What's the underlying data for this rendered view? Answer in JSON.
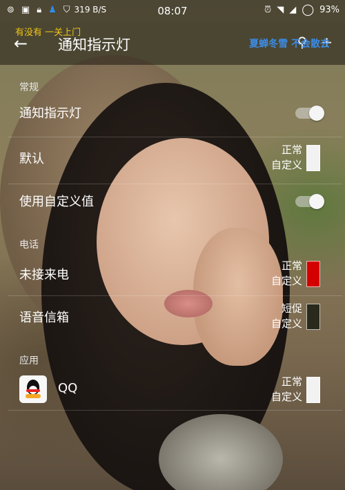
{
  "status_bar": {
    "left_icons": [
      "hotspot-icon",
      "image-icon",
      "lock-icon",
      "qq-icon",
      "shield-icon"
    ],
    "net_speed": "319 B/S",
    "time": "08:07",
    "battery": "93%",
    "right_icons": [
      "alarm-icon",
      "wifi-icon",
      "signal-icon",
      "battery-ring-icon"
    ]
  },
  "toolbar": {
    "marquee_left": "有没有 一关上门",
    "title": "通知指示灯",
    "marquee_right": "夏蝉冬雪 不会散去",
    "actions": [
      "search-icon",
      "add-icon"
    ]
  },
  "sections": {
    "general": {
      "label": "常规",
      "notification_light": "通知指示灯",
      "default": {
        "label": "默认",
        "status1": "正常",
        "status2": "自定义",
        "color": "#f2f2f2"
      },
      "use_custom": "使用自定义值"
    },
    "phone": {
      "label": "电话",
      "missed_call": {
        "label": "未接来电",
        "status1": "正常",
        "status2": "自定义",
        "color": "#d40000"
      },
      "voicemail": {
        "label": "语音信箱",
        "status1": "短促",
        "status2": "自定义",
        "color": "#2a2a1c"
      }
    },
    "apps": {
      "label": "应用",
      "qq": {
        "label": "QQ",
        "status1": "正常",
        "status2": "自定义",
        "color": "#f2f2f2"
      }
    }
  },
  "toggles": {
    "notification_light": true,
    "use_custom": true
  }
}
